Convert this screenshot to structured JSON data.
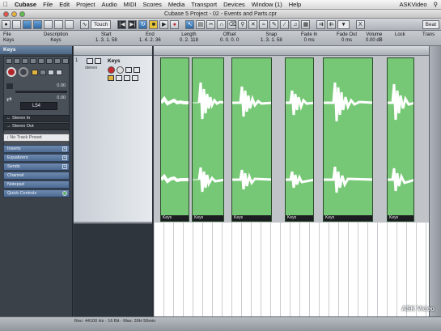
{
  "menubar": {
    "items": [
      "Cubase",
      "File",
      "Edit",
      "Project",
      "Audio",
      "MIDI",
      "Scores",
      "Media",
      "Transport",
      "Devices",
      "Window (1)",
      "Help"
    ],
    "right_label": "ASKVideo"
  },
  "window": {
    "title": "Cubase 5 Project - 02 - Events and Parts.cpr"
  },
  "toolbar": {
    "automation_mode": "Touch",
    "grid_value": "Beat"
  },
  "infoline": {
    "headers": [
      "File",
      "Description",
      "Start",
      "End",
      "Length",
      "Offset",
      "Snap",
      "Fade In",
      "Fade Out",
      "Volume",
      "Lock",
      "Trans"
    ],
    "values": [
      "Keys",
      "Keys",
      "1. 3. 1. 58",
      "1. 4. 2. 36",
      "0. 2. 118",
      "0. 0. 0. 0",
      "1. 3. 1. 58",
      "0 ms",
      "0 ms",
      "0.00 dB",
      "",
      ""
    ]
  },
  "inspector": {
    "track_title": "Keys",
    "volume": "0.00",
    "pan": "0.00",
    "pan_label": "L54",
    "input": "Stereo In",
    "output": "Stereo Out",
    "preset": "No Track Preset",
    "sections": [
      "Inserts",
      "Equalizers",
      "Sends",
      "Channel",
      "Notepad",
      "Quick Controls"
    ]
  },
  "track": {
    "number": "1",
    "name": "Keys",
    "type": "stereo"
  },
  "events": [
    "Keys",
    "Keys",
    "Keys",
    "Keys",
    "Keys",
    "Keys"
  ],
  "status": {
    "text": "Rec: 44100 Hz - 16 Bit - Max: 30H 56min"
  },
  "watermark": "ASK Video"
}
